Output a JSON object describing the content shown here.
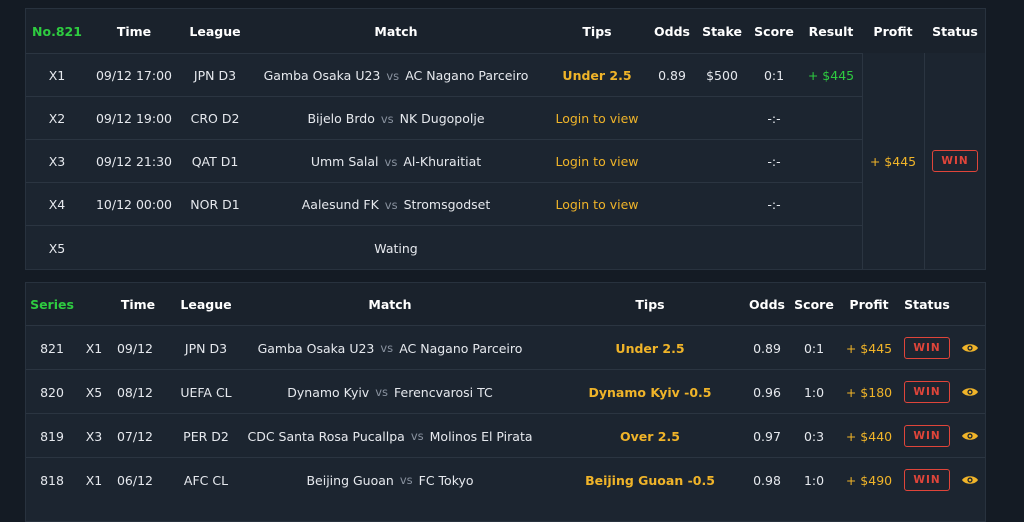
{
  "top_table": {
    "headers": {
      "number": "No.821",
      "time": "Time",
      "league": "League",
      "match": "Match",
      "tips": "Tips",
      "odds": "Odds",
      "stake": "Stake",
      "score": "Score",
      "result": "Result",
      "profit": "Profit",
      "status": "Status"
    },
    "rows": [
      {
        "id": "X1",
        "time": "09/12 17:00",
        "league": "JPN D3",
        "home": "Gamba Osaka U23",
        "vs": "vs",
        "away": "AC Nagano Parceiro",
        "tips": "Under 2.5",
        "odds": "0.89",
        "stake": "$500",
        "score": "0:1",
        "result": "+ $445"
      },
      {
        "id": "X2",
        "time": "09/12 19:00",
        "league": "CRO D2",
        "home": "Bijelo Brdo",
        "vs": "vs",
        "away": "NK Dugopolje",
        "tips": "Login to view",
        "score": "-:-"
      },
      {
        "id": "X3",
        "time": "09/12 21:30",
        "league": "QAT D1",
        "home": "Umm Salal",
        "vs": "vs",
        "away": "Al-Khuraitiat",
        "tips": "Login to view",
        "score": "-:-"
      },
      {
        "id": "X4",
        "time": "10/12 00:00",
        "league": "NOR D1",
        "home": "Aalesund FK",
        "vs": "vs",
        "away": "Stromsgodset",
        "tips": "Login to view",
        "score": "-:-"
      },
      {
        "id": "X5",
        "match_text": "Wating"
      }
    ],
    "total_profit": "+ $445",
    "status": "WIN"
  },
  "series_table": {
    "headers": {
      "series": "Series",
      "time": "Time",
      "league": "League",
      "match": "Match",
      "tips": "Tips",
      "odds": "Odds",
      "score": "Score",
      "profit": "Profit",
      "status": "Status"
    },
    "rows": [
      {
        "series": "821",
        "pick": "X1",
        "date": "09/12",
        "league": "JPN D3",
        "home": "Gamba Osaka U23",
        "vs": "vs",
        "away": "AC Nagano Parceiro",
        "tips": "Under 2.5",
        "odds": "0.89",
        "score": "0:1",
        "profit": "+ $445",
        "status": "WIN"
      },
      {
        "series": "820",
        "pick": "X5",
        "date": "08/12",
        "league": "UEFA CL",
        "home": "Dynamo Kyiv",
        "vs": "vs",
        "away": "Ferencvarosi TC",
        "tips": "Dynamo Kyiv -0.5",
        "odds": "0.96",
        "score": "1:0",
        "profit": "+ $180",
        "status": "WIN"
      },
      {
        "series": "819",
        "pick": "X3",
        "date": "07/12",
        "league": "PER D2",
        "home": "CDC Santa Rosa Pucallpa",
        "vs": "vs",
        "away": "Molinos El Pirata",
        "tips": "Over 2.5",
        "odds": "0.97",
        "score": "0:3",
        "profit": "+ $440",
        "status": "WIN"
      },
      {
        "series": "818",
        "pick": "X1",
        "date": "06/12",
        "league": "AFC CL",
        "home": "Beijing Guoan",
        "vs": "vs",
        "away": "FC Tokyo",
        "tips": "Beijing Guoan -0.5",
        "odds": "0.98",
        "score": "1:0",
        "profit": "+ $490",
        "status": "WIN"
      }
    ],
    "view_icon": "eye-icon"
  },
  "colors": {
    "background": "#141b24",
    "panel": "#1c2530",
    "green": "#2ecc40",
    "gold": "#f0b429",
    "win_red": "#e0453a"
  }
}
